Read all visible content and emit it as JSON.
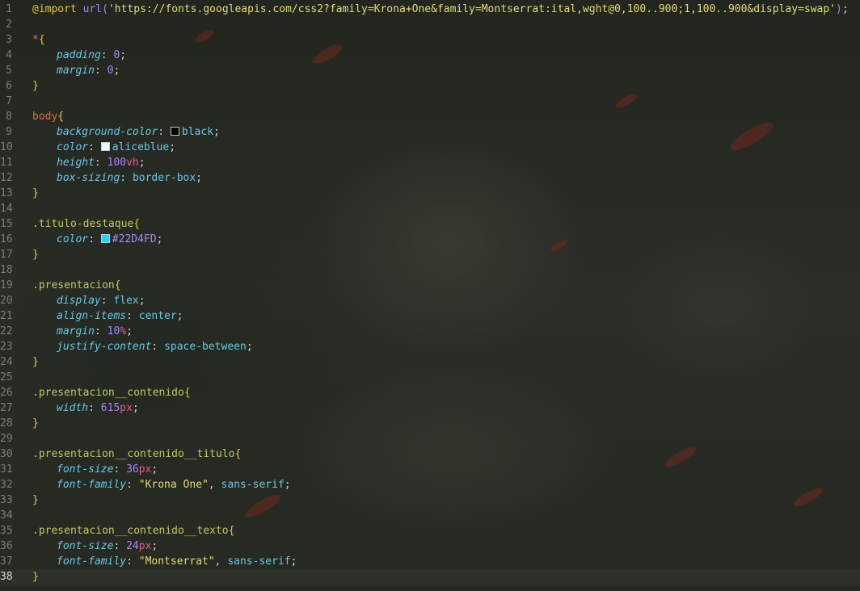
{
  "editor": {
    "current_line": 38,
    "lines": [
      {
        "n": "1",
        "tokens": [
          [
            "at",
            "@import"
          ],
          [
            "punct",
            " "
          ],
          [
            "urlp",
            "url("
          ],
          [
            "str",
            "'https://fonts.googleapis.com/css2?family=Krona+One&family=Montserrat:ital,wght@0,100..900;1,100..900&display=swap'"
          ],
          [
            "urlp",
            ")"
          ],
          [
            "punct",
            ";"
          ]
        ]
      },
      {
        "n": "2",
        "tokens": []
      },
      {
        "n": "3",
        "tokens": [
          [
            "sel-el",
            "*"
          ],
          [
            "brace",
            "{"
          ]
        ]
      },
      {
        "n": "4",
        "tokens": [
          [
            "indent",
            ""
          ],
          [
            "prop",
            "padding"
          ],
          [
            "punct",
            ": "
          ],
          [
            "num",
            "0"
          ],
          [
            "punct",
            ";"
          ]
        ]
      },
      {
        "n": "5",
        "tokens": [
          [
            "indent",
            ""
          ],
          [
            "prop",
            "margin"
          ],
          [
            "punct",
            ": "
          ],
          [
            "num",
            "0"
          ],
          [
            "punct",
            ";"
          ]
        ]
      },
      {
        "n": "6",
        "tokens": [
          [
            "brace",
            "}"
          ]
        ]
      },
      {
        "n": "7",
        "tokens": []
      },
      {
        "n": "8",
        "tokens": [
          [
            "sel-el",
            "body"
          ],
          [
            "brace",
            "{"
          ]
        ]
      },
      {
        "n": "9",
        "tokens": [
          [
            "indent",
            ""
          ],
          [
            "prop",
            "background-color"
          ],
          [
            "punct",
            ": "
          ],
          [
            "swatch",
            "#000000"
          ],
          [
            "val",
            "black"
          ],
          [
            "punct",
            ";"
          ]
        ]
      },
      {
        "n": "10",
        "tokens": [
          [
            "indent",
            ""
          ],
          [
            "prop",
            "color"
          ],
          [
            "punct",
            ": "
          ],
          [
            "swatch",
            "#f0f8ff"
          ],
          [
            "val",
            "aliceblue"
          ],
          [
            "punct",
            ";"
          ]
        ]
      },
      {
        "n": "11",
        "tokens": [
          [
            "indent",
            ""
          ],
          [
            "prop",
            "height"
          ],
          [
            "punct",
            ": "
          ],
          [
            "num",
            "100"
          ],
          [
            "unit",
            "vh"
          ],
          [
            "punct",
            ";"
          ]
        ]
      },
      {
        "n": "12",
        "tokens": [
          [
            "indent",
            ""
          ],
          [
            "prop",
            "box-sizing"
          ],
          [
            "punct",
            ": "
          ],
          [
            "val",
            "border-box"
          ],
          [
            "punct",
            ";"
          ]
        ]
      },
      {
        "n": "13",
        "tokens": [
          [
            "brace",
            "}"
          ]
        ]
      },
      {
        "n": "14",
        "tokens": []
      },
      {
        "n": "15",
        "tokens": [
          [
            "sel-cls",
            ".titulo-destaque"
          ],
          [
            "brace",
            "{"
          ]
        ]
      },
      {
        "n": "16",
        "tokens": [
          [
            "indent",
            ""
          ],
          [
            "prop",
            "color"
          ],
          [
            "punct",
            ": "
          ],
          [
            "swatch",
            "#22D4FD"
          ],
          [
            "num",
            "#22D4FD"
          ],
          [
            "punct",
            ";"
          ]
        ]
      },
      {
        "n": "17",
        "tokens": [
          [
            "brace",
            "}"
          ]
        ]
      },
      {
        "n": "18",
        "tokens": []
      },
      {
        "n": "19",
        "tokens": [
          [
            "sel-cls",
            ".presentacion"
          ],
          [
            "brace",
            "{"
          ]
        ]
      },
      {
        "n": "20",
        "tokens": [
          [
            "indent",
            ""
          ],
          [
            "prop",
            "display"
          ],
          [
            "punct",
            ": "
          ],
          [
            "val",
            "flex"
          ],
          [
            "punct",
            ";"
          ]
        ]
      },
      {
        "n": "21",
        "tokens": [
          [
            "indent",
            ""
          ],
          [
            "prop",
            "align-items"
          ],
          [
            "punct",
            ": "
          ],
          [
            "val",
            "center"
          ],
          [
            "punct",
            ";"
          ]
        ]
      },
      {
        "n": "22",
        "tokens": [
          [
            "indent",
            ""
          ],
          [
            "prop",
            "margin"
          ],
          [
            "punct",
            ": "
          ],
          [
            "num",
            "10"
          ],
          [
            "unit",
            "%"
          ],
          [
            "punct",
            ";"
          ]
        ]
      },
      {
        "n": "23",
        "tokens": [
          [
            "indent",
            ""
          ],
          [
            "prop",
            "justify-content"
          ],
          [
            "punct",
            ": "
          ],
          [
            "val",
            "space-between"
          ],
          [
            "punct",
            ";"
          ]
        ]
      },
      {
        "n": "24",
        "tokens": [
          [
            "brace",
            "}"
          ]
        ]
      },
      {
        "n": "25",
        "tokens": []
      },
      {
        "n": "26",
        "tokens": [
          [
            "sel-cls",
            ".presentacion__contenido"
          ],
          [
            "brace",
            "{"
          ]
        ]
      },
      {
        "n": "27",
        "tokens": [
          [
            "indent",
            ""
          ],
          [
            "prop",
            "width"
          ],
          [
            "punct",
            ": "
          ],
          [
            "num",
            "615"
          ],
          [
            "unit",
            "px"
          ],
          [
            "punct",
            ";"
          ]
        ]
      },
      {
        "n": "28",
        "tokens": [
          [
            "brace",
            "}"
          ]
        ]
      },
      {
        "n": "29",
        "tokens": []
      },
      {
        "n": "30",
        "tokens": [
          [
            "sel-cls",
            ".presentacion__contenido__titulo"
          ],
          [
            "brace",
            "{"
          ]
        ]
      },
      {
        "n": "31",
        "tokens": [
          [
            "indent",
            ""
          ],
          [
            "prop",
            "font-size"
          ],
          [
            "punct",
            ": "
          ],
          [
            "num",
            "36"
          ],
          [
            "unit",
            "px"
          ],
          [
            "punct",
            ";"
          ]
        ]
      },
      {
        "n": "32",
        "tokens": [
          [
            "indent",
            ""
          ],
          [
            "prop",
            "font-family"
          ],
          [
            "punct",
            ": "
          ],
          [
            "str",
            "\"Krona One\""
          ],
          [
            "punct",
            ", "
          ],
          [
            "val",
            "sans-serif"
          ],
          [
            "punct",
            ";"
          ]
        ]
      },
      {
        "n": "33",
        "tokens": [
          [
            "brace",
            "}"
          ]
        ]
      },
      {
        "n": "34",
        "tokens": []
      },
      {
        "n": "35",
        "tokens": [
          [
            "sel-cls",
            ".presentacion__contenido__texto"
          ],
          [
            "brace",
            "{"
          ]
        ]
      },
      {
        "n": "36",
        "tokens": [
          [
            "indent",
            ""
          ],
          [
            "prop",
            "font-size"
          ],
          [
            "punct",
            ": "
          ],
          [
            "num",
            "24"
          ],
          [
            "unit",
            "px"
          ],
          [
            "punct",
            ";"
          ]
        ]
      },
      {
        "n": "37",
        "tokens": [
          [
            "indent",
            ""
          ],
          [
            "prop",
            "font-family"
          ],
          [
            "punct",
            ": "
          ],
          [
            "str",
            "\"Montserrat\""
          ],
          [
            "punct",
            ", "
          ],
          [
            "val",
            "sans-serif"
          ],
          [
            "punct",
            ";"
          ]
        ]
      },
      {
        "n": "38",
        "tokens": [
          [
            "brace",
            "}"
          ]
        ]
      }
    ]
  }
}
